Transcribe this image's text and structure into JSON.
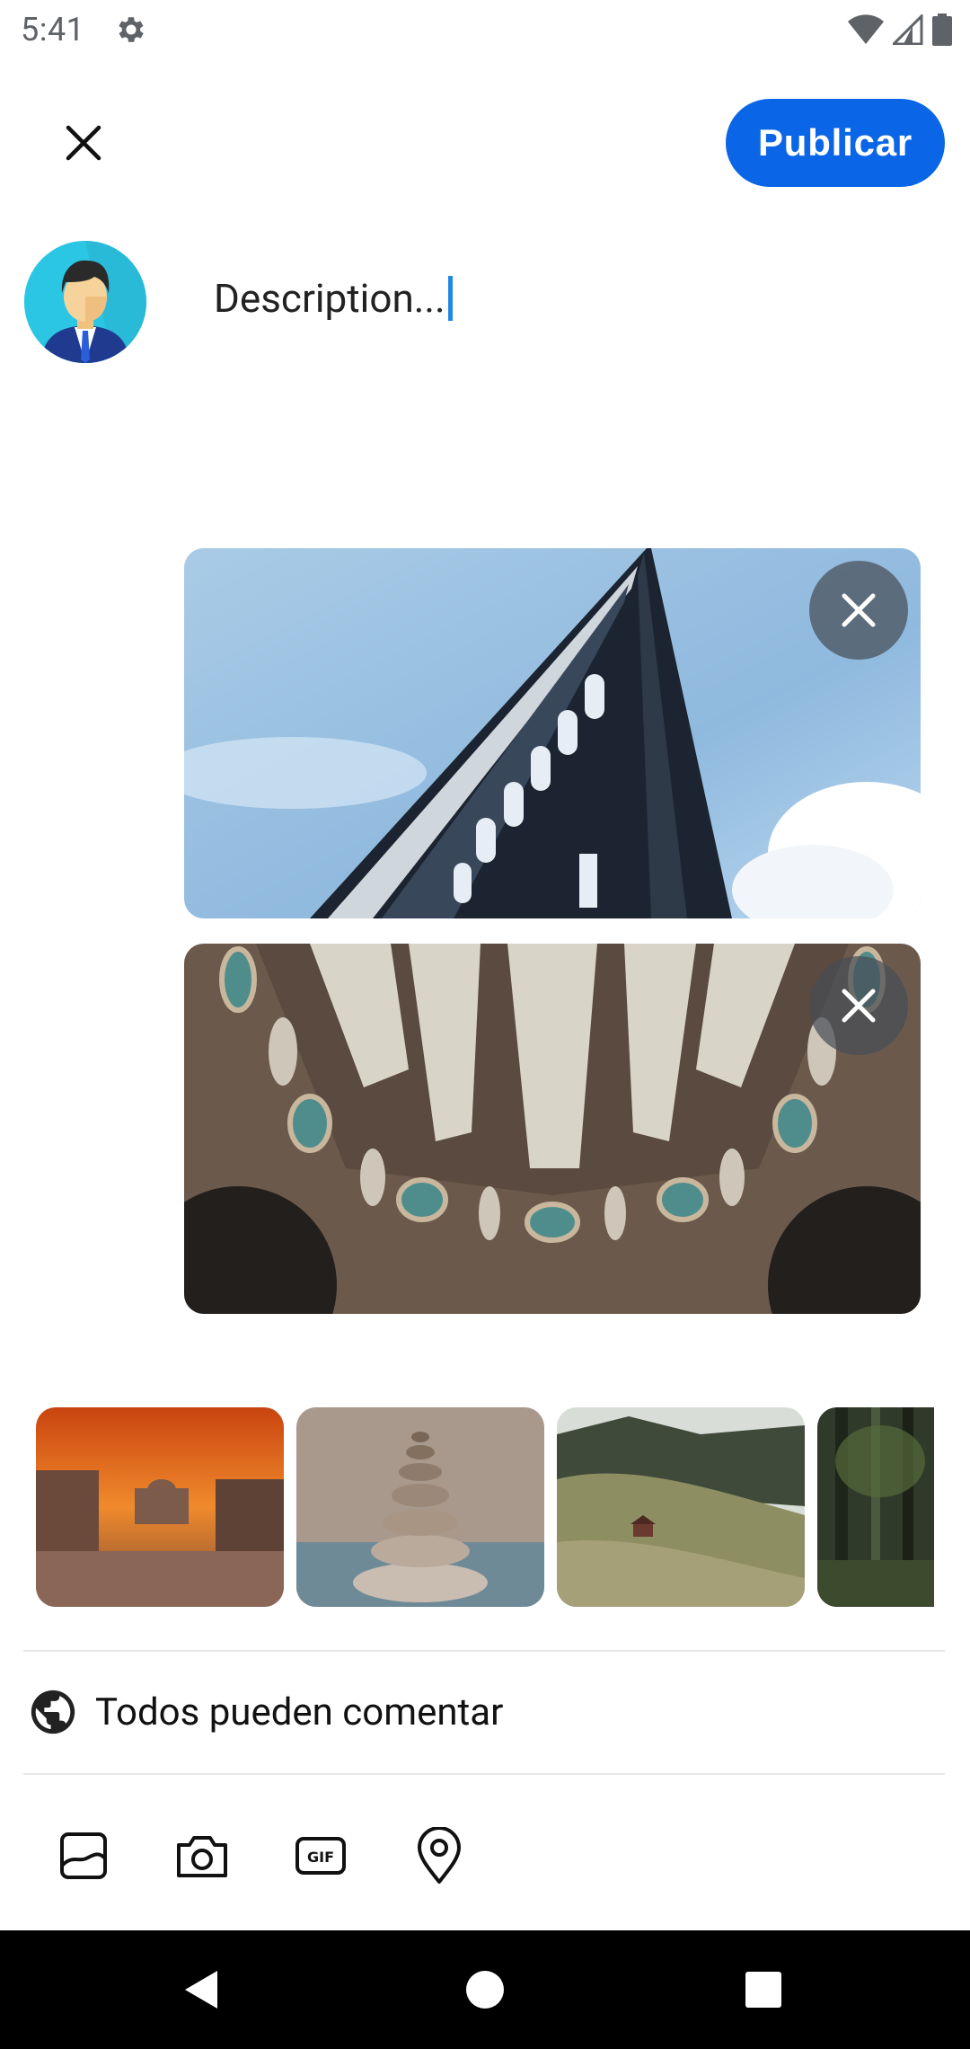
{
  "status_bar": {
    "time": "5:41",
    "icons": [
      "gear-icon",
      "wifi-icon",
      "signal-icon",
      "battery-icon"
    ]
  },
  "header": {
    "close_icon": "close-icon",
    "publish_label": "Publicar",
    "accent_color": "#0a66e6"
  },
  "composer": {
    "description_placeholder": "Description...",
    "avatar": "avatar"
  },
  "attachments": [
    {
      "name": "building-photo",
      "remove_icon": "close-icon"
    },
    {
      "name": "dome-inscription-photo",
      "remove_icon": "close-icon"
    }
  ],
  "gallery": [
    {
      "name": "venice-canal-thumbnail"
    },
    {
      "name": "stacked-stones-thumbnail"
    },
    {
      "name": "valley-hut-thumbnail"
    },
    {
      "name": "forest-thumbnail"
    }
  ],
  "comment_permission": {
    "icon": "globe-icon",
    "label": "Todos pueden comentar"
  },
  "toolbar": {
    "icons": [
      "gallery-icon",
      "camera-icon",
      "gif-icon",
      "location-pin-icon"
    ]
  },
  "nav": {
    "icons": [
      "back-icon",
      "home-icon",
      "recents-icon"
    ]
  }
}
